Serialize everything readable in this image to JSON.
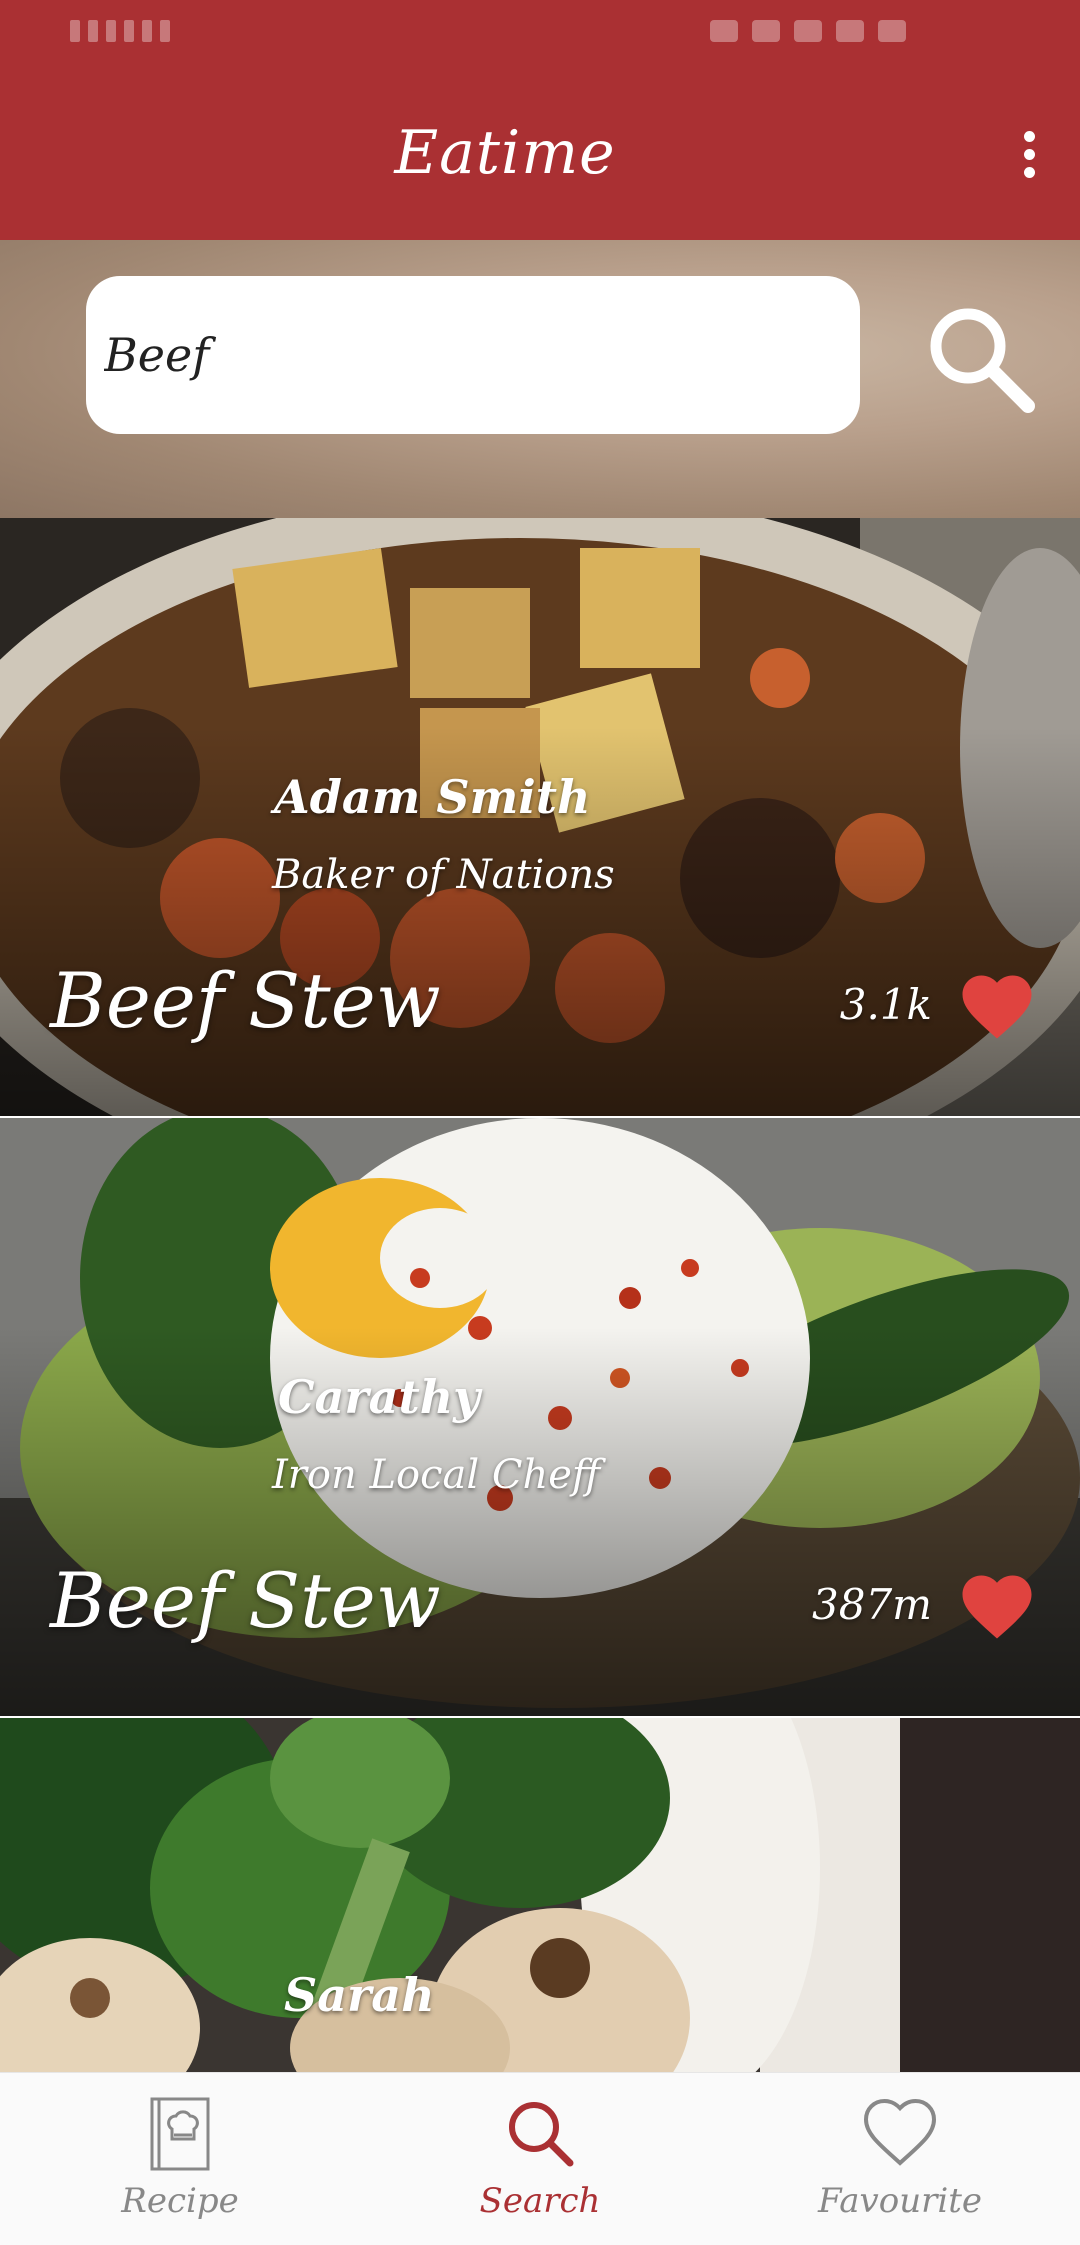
{
  "colors": {
    "primary": "#aa3033",
    "heart": "#e0433f",
    "nav_inactive": "#888888"
  },
  "app": {
    "title": "Eatime",
    "menu_icon": "more-vert-icon"
  },
  "search": {
    "value": "Beef",
    "button_icon": "search-icon"
  },
  "recipes": [
    {
      "author": "Adam Smith",
      "author_title": "Baker of Nations",
      "dish": "Beef Stew",
      "count": "3.1k",
      "favorite_icon": "heart-icon"
    },
    {
      "author": "Carathy",
      "author_title": "Iron Local Cheff",
      "dish": "Beef Stew",
      "count": "387m",
      "favorite_icon": "heart-icon"
    },
    {
      "author": "Sarah",
      "author_title": "",
      "dish": "",
      "count": "",
      "favorite_icon": "heart-icon"
    }
  ],
  "bottom_nav": [
    {
      "label": "Recipe",
      "icon": "recipe-book-icon",
      "active": false
    },
    {
      "label": "Search",
      "icon": "search-icon",
      "active": true
    },
    {
      "label": "Favourite",
      "icon": "heart-outline-icon",
      "active": false
    }
  ]
}
